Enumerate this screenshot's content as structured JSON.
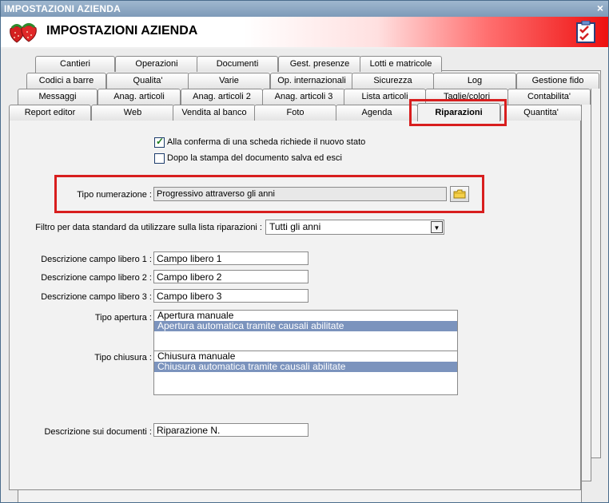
{
  "window": {
    "title": "IMPOSTAZIONI AZIENDA",
    "close_label": "×"
  },
  "header": {
    "title": "IMPOSTAZIONI AZIENDA"
  },
  "tabs": {
    "row1": [
      "Cantieri",
      "Operazioni",
      "Documenti",
      "Gest. presenze",
      "Lotti e matricole"
    ],
    "row2": [
      "Codici a barre",
      "Qualita'",
      "Varie",
      "Op. internazionali",
      "Sicurezza",
      "Log",
      "Gestione fido"
    ],
    "row3": [
      "Messaggi",
      "Anag. articoli",
      "Anag. articoli 2",
      "Anag. articoli 3",
      "Lista articoli",
      "Taglie/colori",
      "Contabilita'"
    ],
    "row4": [
      "Report editor",
      "Web",
      "Vendita al banco",
      "Foto",
      "Agenda",
      "Riparazioni",
      "Quantita'"
    ],
    "active": "Riparazioni"
  },
  "form": {
    "cb1_label": "Alla conferma di una scheda richiede il nuovo stato",
    "cb1_checked": true,
    "cb2_label": "Dopo la stampa del documento salva ed esci",
    "cb2_checked": false,
    "numbering_label": "Tipo numerazione :",
    "numbering_value": "Progressivo attraverso gli anni",
    "filter_label": "Filtro per data standard da utilizzare sulla lista riparazioni :",
    "filter_value": "Tutti gli anni",
    "free1_label": "Descrizione campo libero 1 :",
    "free1_value": "Campo libero 1",
    "free2_label": "Descrizione campo libero 2 :",
    "free2_value": "Campo libero 2",
    "free3_label": "Descrizione campo libero 3 :",
    "free3_value": "Campo libero 3",
    "opening_label": "Tipo apertura :",
    "opening_options": [
      "Apertura manuale",
      "Apertura automatica tramite causali abilitate"
    ],
    "opening_selected": 1,
    "closing_label": "Tipo chiusura :",
    "closing_options": [
      "Chiusura manuale",
      "Chiusura automatica tramite causali abilitate"
    ],
    "closing_selected": 1,
    "docdesc_label": "Descrizione sui documenti :",
    "docdesc_value": "Riparazione N."
  },
  "colors": {
    "highlight": "#d81e1e",
    "selection": "#7b93bd"
  }
}
